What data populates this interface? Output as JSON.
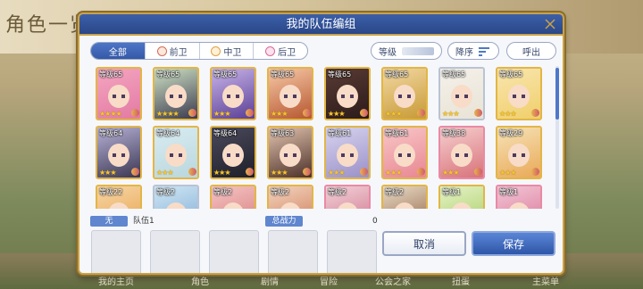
{
  "background": {
    "title": "角色一览",
    "tabs": [
      "我的主页",
      "角色",
      "剧情",
      "冒险",
      "公会之家",
      "扭蛋",
      "主菜单"
    ]
  },
  "modal": {
    "title": "我的队伍编组"
  },
  "filters": {
    "all": "全部",
    "front": "前卫",
    "middle": "中卫",
    "back": "后卫",
    "level_label": "等级",
    "sort_label": "降序",
    "call_label": "呼出"
  },
  "characters": [
    {
      "level": "等级65",
      "stars": "★★★★",
      "hue": "#f4a6c0",
      "hair": "#e37aa3",
      "frame": "gold"
    },
    {
      "level": "等级65",
      "stars": "★★★★",
      "hue": "#cfe2c4",
      "hair": "#3b3b4f",
      "frame": "gold"
    },
    {
      "level": "等级65",
      "stars": "★★★",
      "hue": "#c9b4e8",
      "hair": "#5a3f96",
      "frame": "gold"
    },
    {
      "level": "等级65",
      "stars": "★★★",
      "hue": "#f7c9a8",
      "hair": "#b6572f",
      "frame": "gold"
    },
    {
      "level": "等级65",
      "stars": "★★★",
      "hue": "#5a3b34",
      "hair": "#2b1b1a",
      "frame": "gold"
    },
    {
      "level": "等级65",
      "stars": "★★★",
      "hue": "#f3d8a3",
      "hair": "#c79a35",
      "frame": "gold"
    },
    {
      "level": "等级65",
      "stars": "★★★",
      "hue": "#f4f1ea",
      "hair": "#e9e3d6",
      "frame": "silver"
    },
    {
      "level": "等级65",
      "stars": "★★★",
      "hue": "#f9e6b0",
      "hair": "#f0cf6a",
      "frame": "gold"
    },
    {
      "level": "等级64",
      "stars": "★★★",
      "hue": "#b7b2d6",
      "hair": "#3a3652",
      "frame": "gold"
    },
    {
      "level": "等级64",
      "stars": "★★★",
      "hue": "#d9ecf1",
      "hair": "#b9d7de",
      "frame": "gold"
    },
    {
      "level": "等级64",
      "stars": "★★★",
      "hue": "#4a4a5c",
      "hair": "#1f1f2a",
      "frame": "gold"
    },
    {
      "level": "等级63",
      "stars": "★★★",
      "hue": "#e4c4b0",
      "hair": "#4b3028",
      "frame": "gold"
    },
    {
      "level": "等级61",
      "stars": "★★★",
      "hue": "#d8d4ef",
      "hair": "#9a90c8",
      "frame": "gold"
    },
    {
      "level": "等级61",
      "stars": "★★★",
      "hue": "#f8c7c8",
      "hair": "#e88792",
      "frame": "gold"
    },
    {
      "level": "等级38",
      "stars": "★★★",
      "hue": "#f6cfcf",
      "hair": "#d8727a",
      "frame": "pink"
    },
    {
      "level": "等级29",
      "stars": "★★★",
      "hue": "#f6e3b8",
      "hair": "#e9a957",
      "frame": "gold"
    },
    {
      "level": "等级22",
      "stars": "",
      "hue": "#f7d6a6",
      "hair": "#e59f47",
      "frame": "gold"
    },
    {
      "level": "等级2",
      "stars": "",
      "hue": "#cfe6f4",
      "hair": "#7aa7d2",
      "frame": "silver"
    },
    {
      "level": "等级2",
      "stars": "",
      "hue": "#f4c4c4",
      "hair": "#d67575",
      "frame": "gold"
    },
    {
      "level": "等级2",
      "stars": "",
      "hue": "#f3d4c0",
      "hair": "#c9734a",
      "frame": "gold"
    },
    {
      "level": "等级2",
      "stars": "",
      "hue": "#f2d2d8",
      "hair": "#cc6b86",
      "frame": "pink"
    },
    {
      "level": "等级2",
      "stars": "",
      "hue": "#eadcc8",
      "hair": "#8a5a3a",
      "frame": "gold"
    },
    {
      "level": "等级1",
      "stars": "",
      "hue": "#e5f3c8",
      "hair": "#a3c95a",
      "frame": "gold"
    },
    {
      "level": "等级1",
      "stars": "",
      "hue": "#f2c6d6",
      "hair": "#d86f92",
      "frame": "pink"
    }
  ],
  "team": {
    "tag": "无",
    "name": "队伍1",
    "power_label": "总战力",
    "power_value": "0"
  },
  "buttons": {
    "cancel": "取消",
    "save": "保存"
  },
  "colors": {
    "accent": "#3559a8",
    "gold_frame": "#e2b645",
    "header": "#2a4788"
  }
}
